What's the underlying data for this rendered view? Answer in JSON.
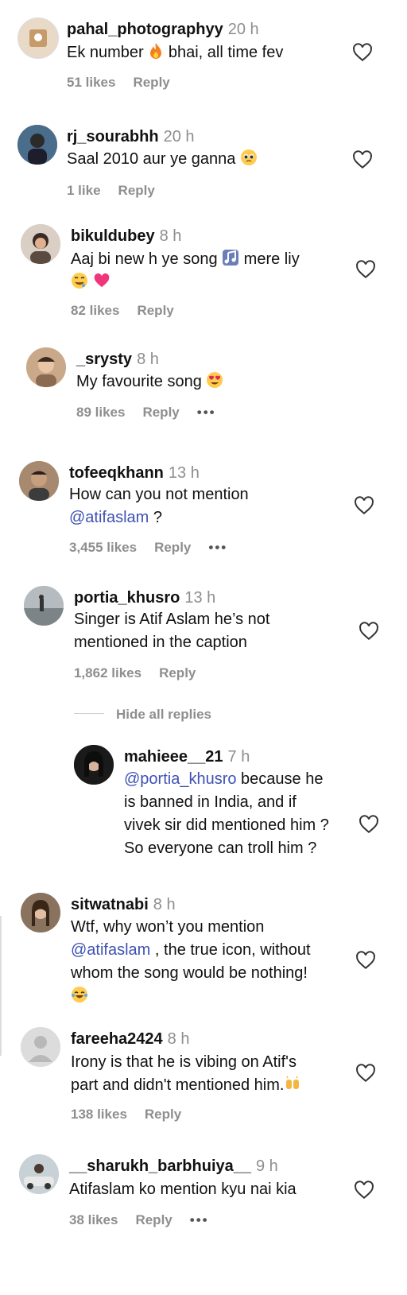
{
  "comments": [
    {
      "user": "pahal_photographyy",
      "time": "20 h",
      "text_a": "Ek number",
      "text_b": " bhai, all time fev",
      "likes": "51 likes",
      "reply": "Reply"
    },
    {
      "user": "rj_sourabhh",
      "time": "20 h",
      "text": "Saal 2010 aur ye ganna",
      "likes": "1 like",
      "reply": "Reply"
    },
    {
      "user": "bikuldubey",
      "time": "8 h",
      "text_a": "Aaj bi new h ye song",
      "text_b": " mere liy",
      "likes": "82 likes",
      "reply": "Reply"
    },
    {
      "user": "_srysty",
      "time": "8 h",
      "text": "My favourite song",
      "likes": "89 likes",
      "reply": "Reply",
      "more": "•••"
    },
    {
      "user": "tofeeqkhann",
      "time": "13 h",
      "text": "How can you not mention",
      "mention": "@atifaslam",
      "text_after": " ?",
      "likes": "3,455 likes",
      "reply": "Reply",
      "more": "•••"
    },
    {
      "user": "portia_khusro",
      "time": "13 h",
      "line1": "Singer is Atif Aslam he’s not",
      "line2": "mentioned in the caption",
      "likes": "1,862 likes",
      "reply": "Reply",
      "hide_replies": "Hide all replies"
    },
    {
      "user": "mahieee__21",
      "time": "7 h",
      "mention": "@portia_khusro",
      "line1_rest": " because he",
      "line2": "is banned in India, and if",
      "line3": "vivek sir did mentioned him ?",
      "line4": "So everyone can troll him ?"
    },
    {
      "user": "sitwatnabi",
      "time": "8 h",
      "line1": "Wtf, why won’t you mention",
      "mention": "@atifaslam",
      "line2_rest": " , the true icon, without",
      "line3": "whom the song would be nothing!"
    },
    {
      "user": "fareeha2424",
      "time": "8 h",
      "line1": "Irony is that he is vibing on Atif's",
      "line2": "part and didn't mentioned him.",
      "likes": "138 likes",
      "reply": "Reply"
    },
    {
      "user": "__sharukh_barbhuiya__",
      "time": "9 h",
      "text": "Atifaslam ko mention kyu nai kia",
      "likes": "38 likes",
      "reply": "Reply",
      "more": "•••"
    }
  ],
  "icons": {
    "like": "heart-outline-icon",
    "more": "more-dots-icon"
  },
  "colors": {
    "mention": "#3f51b5",
    "meta": "#8e8e8e"
  }
}
